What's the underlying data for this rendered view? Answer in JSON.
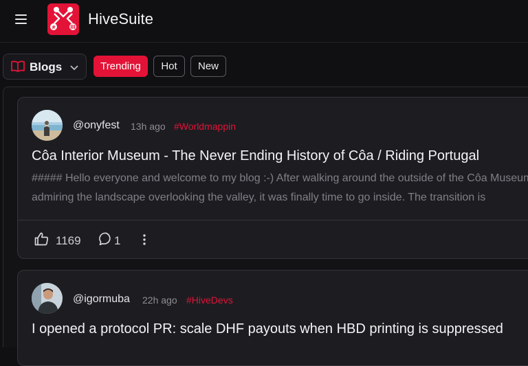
{
  "app": {
    "title": "HiveSuite"
  },
  "icons": {
    "menu": "hamburger-menu-icon",
    "logo": "hivesuite-logo-icon",
    "blogs": "open-book-icon",
    "chevron": "chevron-down-icon",
    "upvote": "thumbs-up-icon",
    "comments": "comment-bubble-icon",
    "more": "vertical-ellipsis-icon"
  },
  "colors": {
    "accent": "#e31337",
    "background": "#101013",
    "card": "#1d1d21"
  },
  "filter": {
    "selector_label": "Blogs",
    "tabs": [
      {
        "label": "Trending",
        "active": true
      },
      {
        "label": "Hot",
        "active": false
      },
      {
        "label": "New",
        "active": false
      }
    ]
  },
  "posts": [
    {
      "author": "@onyfest",
      "time_ago": "13h ago",
      "tag": "#Worldmappin",
      "title": "Côa Interior Museum - The Never Ending History of Côa / Riding Portugal",
      "excerpt_lines": [
        "##### Hello everyone and welcome to my blog :-) After walking around the outside of the Côa Museum,",
        "admiring the landscape overlooking the valley, it was finally time to go inside. The transition is"
      ],
      "upvotes": "1169",
      "comments": "1"
    },
    {
      "author": "@igormuba",
      "time_ago": "22h ago",
      "tag": "#HiveDevs",
      "title": "I opened a protocol PR: scale DHF payouts when HBD printing is suppressed"
    }
  ]
}
